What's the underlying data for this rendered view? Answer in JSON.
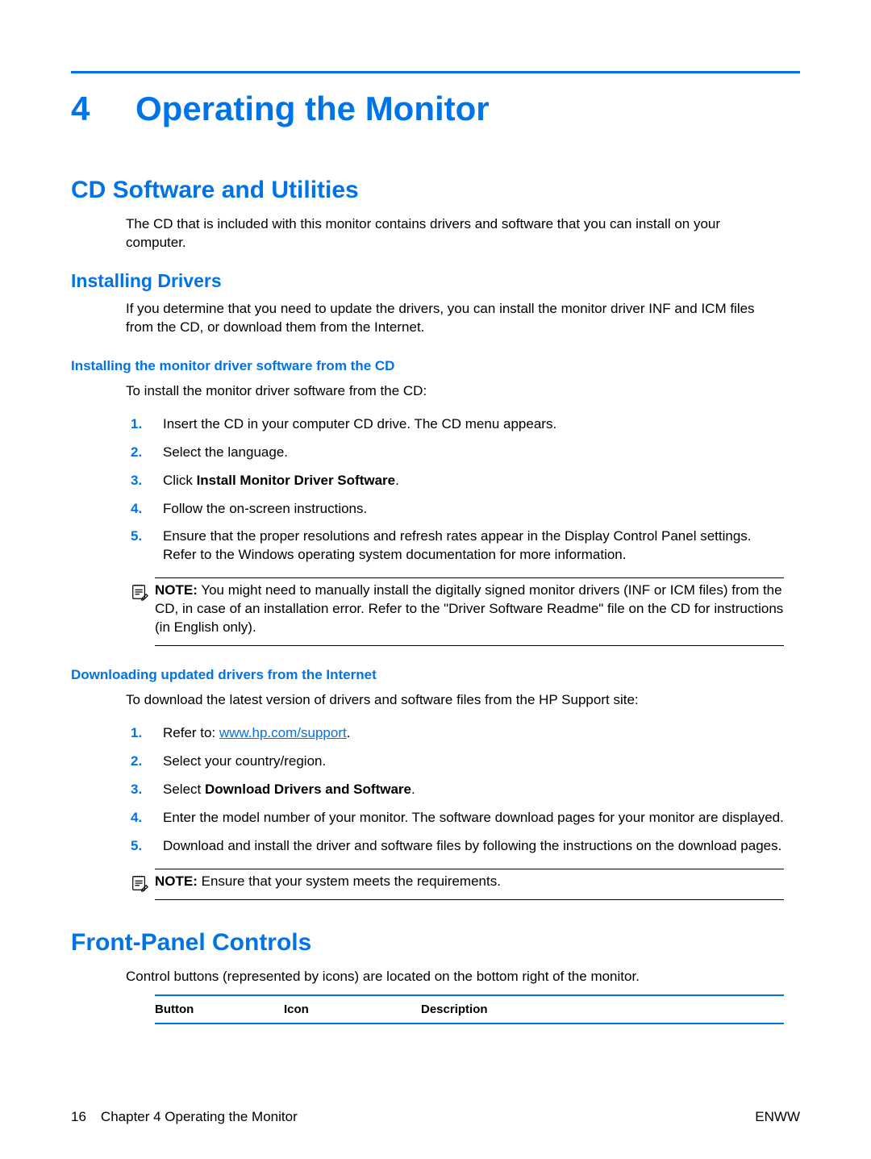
{
  "chapter": {
    "number": "4",
    "title": "Operating the Monitor"
  },
  "section_cd": {
    "heading": "CD Software and Utilities",
    "intro": "The CD that is included with this monitor contains drivers and software that you can install on your computer."
  },
  "installing_drivers": {
    "heading": "Installing Drivers",
    "intro": "If you determine that you need to update the drivers, you can install the monitor driver INF and ICM files from the CD, or download them from the Internet."
  },
  "from_cd": {
    "heading": "Installing the monitor driver software from the CD",
    "lead": "To install the monitor driver software from the CD:",
    "step1": "Insert the CD in your computer CD drive. The CD menu appears.",
    "step2": "Select the language.",
    "step3_pre": "Click ",
    "step3_bold": "Install Monitor Driver Software",
    "step3_post": ".",
    "step4": "Follow the on-screen instructions.",
    "step5": "Ensure that the proper resolutions and refresh rates appear in the Display Control Panel settings. Refer to the Windows operating system documentation for more information.",
    "note_label": "NOTE:",
    "note_body": "You might need to manually install the digitally signed monitor drivers (INF or ICM files) from the CD, in case of an installation error. Refer to the \"Driver Software Readme\" file on the CD for instructions (in English only)."
  },
  "from_net": {
    "heading": "Downloading updated drivers from the Internet",
    "lead": "To download the latest version of drivers and software files from the HP Support site:",
    "step1_pre": "Refer to: ",
    "step1_link": "www.hp.com/support",
    "step1_post": ".",
    "step2": "Select your country/region.",
    "step3_pre": "Select ",
    "step3_bold": "Download Drivers and Software",
    "step3_post": ".",
    "step4": "Enter the model number of your monitor. The software download pages for your monitor are displayed.",
    "step5": "Download and install the driver and software files by following the instructions on the download pages.",
    "note_label": "NOTE:",
    "note_body": "Ensure that your system meets the requirements."
  },
  "front_panel": {
    "heading": "Front-Panel Controls",
    "intro": "Control buttons (represented by icons) are located on the bottom right of the monitor.",
    "table": {
      "col_button": "Button",
      "col_icon": "Icon",
      "col_desc": "Description"
    }
  },
  "footer": {
    "page_number": "16",
    "left": "Chapter 4   Operating the Monitor",
    "right": "ENWW"
  }
}
